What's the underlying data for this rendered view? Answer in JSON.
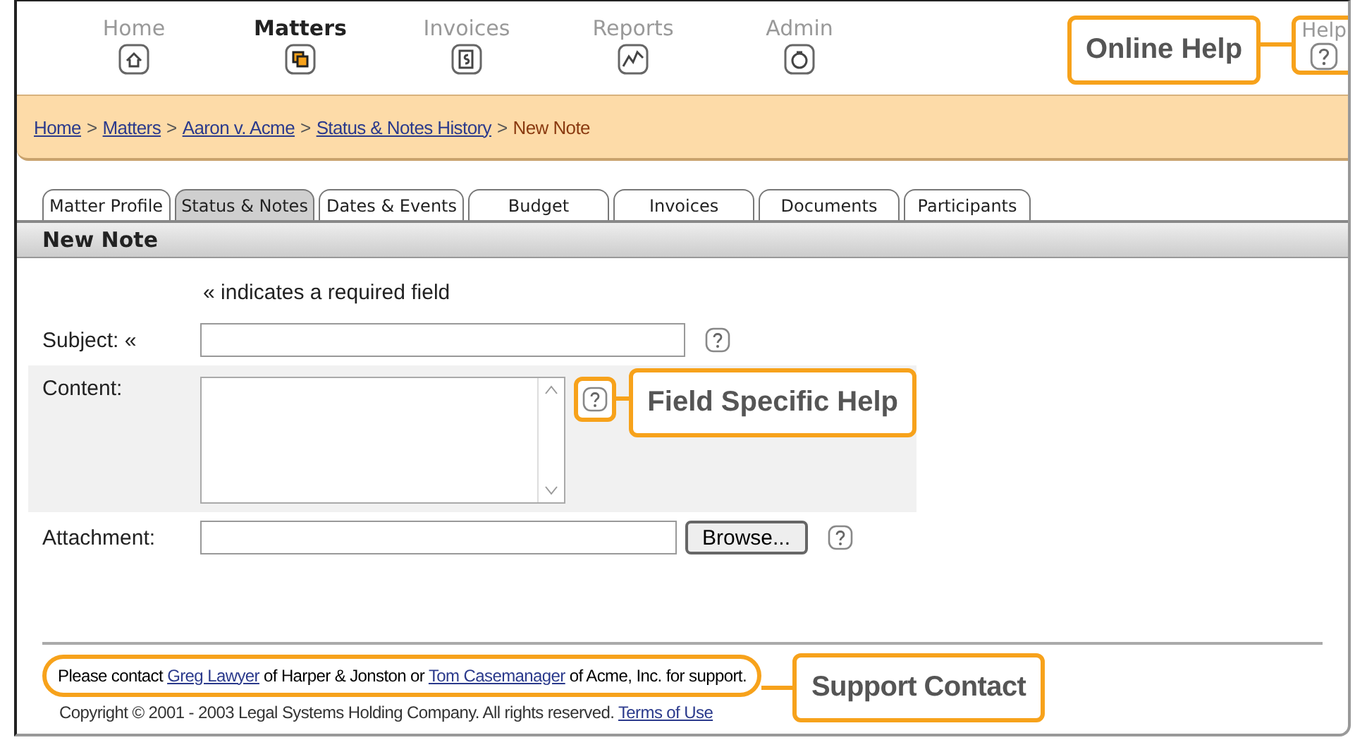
{
  "nav": {
    "items": [
      {
        "label": "Home",
        "selected": false
      },
      {
        "label": "Matters",
        "selected": true
      },
      {
        "label": "Invoices",
        "selected": false
      },
      {
        "label": "Reports",
        "selected": false
      },
      {
        "label": "Admin",
        "selected": false
      }
    ],
    "help": "Help"
  },
  "callouts": {
    "online_help": "Online Help",
    "field_help": "Field Specific Help",
    "support": "Support Contact"
  },
  "breadcrumb": {
    "links": [
      "Home",
      "Matters",
      "Aaron v. Acme",
      "Status & Notes History"
    ],
    "separator": ">",
    "current": "New Note"
  },
  "tabs": [
    {
      "label": "Matter Profile",
      "selected": false
    },
    {
      "label": "Status & Notes",
      "selected": true
    },
    {
      "label": "Dates & Events",
      "selected": false
    },
    {
      "label": "Budget",
      "selected": false
    },
    {
      "label": "Invoices",
      "selected": false
    },
    {
      "label": "Documents",
      "selected": false
    },
    {
      "label": "Participants",
      "selected": false
    }
  ],
  "section_title": "New Note",
  "required_mark": "«",
  "required_note": "indicates a required field",
  "fields": [
    {
      "kind": "text",
      "label": "Subject:",
      "required": true
    },
    {
      "kind": "textarea",
      "label": "Content:",
      "required": false
    },
    {
      "kind": "file",
      "label": "Attachment:",
      "required": false,
      "button": "Browse..."
    }
  ],
  "support": [
    {
      "text": "Please contact "
    },
    {
      "text": "Greg Lawyer",
      "link": true
    },
    {
      "text": " of Harper & Jonston or "
    },
    {
      "text": "Tom Casemanager",
      "link": true
    },
    {
      "text": " of Acme, Inc. for support."
    }
  ],
  "copyright": [
    {
      "text": "Copyright © 2001 - 2003 Legal Systems Holding Company. All rights reserved. "
    },
    {
      "text": "Terms of Use",
      "link": true
    }
  ]
}
